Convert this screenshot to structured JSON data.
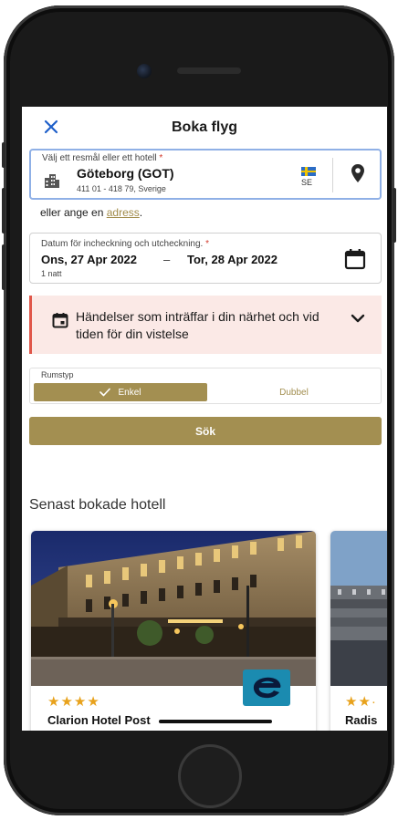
{
  "header": {
    "title": "Boka flyg",
    "close_icon": "close-icon"
  },
  "destination": {
    "label": "Välj ett resmål eller ett hotell",
    "required_mark": "*",
    "value": "Göteborg (GOT)",
    "subtext": "411 01 - 418 79, Sverige",
    "country_code": "SE"
  },
  "alternative": {
    "prefix": "eller ange en ",
    "link": "adress",
    "suffix": "."
  },
  "dates": {
    "label": "Datum för incheckning och utcheckning.",
    "required_mark": "*",
    "checkin": "Ons, 27 Apr 2022",
    "separator": "–",
    "checkout": "Tor, 28 Apr 2022",
    "nights": "1 natt"
  },
  "events": {
    "text": "Händelser som inträffar i din närhet och vid tiden för din vistelse"
  },
  "room_type": {
    "label": "Rumstyp",
    "options": [
      {
        "label": "Enkel",
        "selected": true
      },
      {
        "label": "Dubbel",
        "selected": false
      }
    ]
  },
  "search_button": {
    "label": "Sök"
  },
  "recent": {
    "title": "Senast bokade hotell",
    "hotels": [
      {
        "name": "Clarion Hotel Post",
        "stars": "★★★★"
      },
      {
        "name": "Radis",
        "stars": "★★·"
      }
    ]
  },
  "colors": {
    "accent": "#a38f51",
    "link_blue": "#1e5fc9",
    "alert_bg": "#fbe9e6",
    "alert_border": "#e0574a",
    "star": "#e8a21c"
  }
}
